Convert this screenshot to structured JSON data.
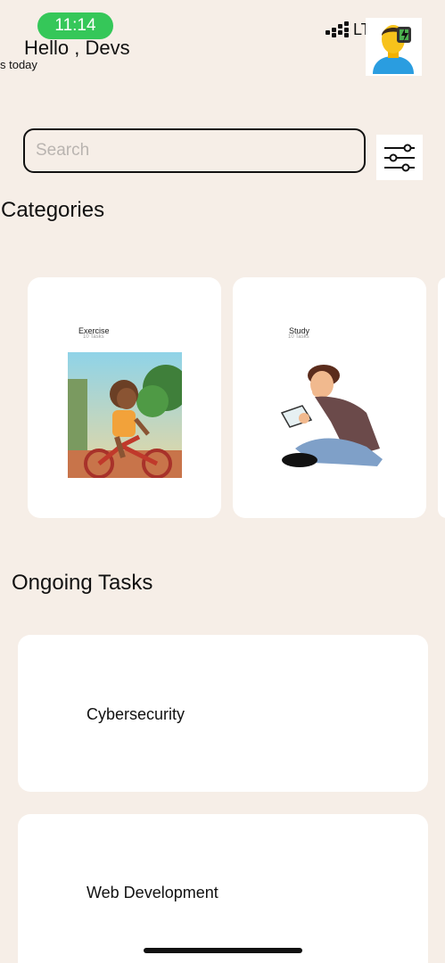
{
  "status_bar": {
    "time": "11:14",
    "network": "LTE",
    "accent_color": "#35c759"
  },
  "header": {
    "greeting": "Hello , Devs",
    "subtitle": "sks today",
    "avatar_icon": "user-avatar-icon"
  },
  "search": {
    "placeholder": "Search",
    "value": "",
    "filter_icon": "sliders-icon"
  },
  "categories": {
    "title": "Categories",
    "items": [
      {
        "title": "Exercise",
        "count": "10 Tasks",
        "image_icon": "boy-on-bicycle-illustration"
      },
      {
        "title": "Study",
        "count": "10 Tasks",
        "image_icon": "man-reading-book-illustration"
      }
    ]
  },
  "ongoing": {
    "title": "Ongoing Tasks",
    "tasks": [
      {
        "title": "Cybersecurity"
      },
      {
        "title": "Web Development"
      }
    ]
  },
  "colors": {
    "background": "#f6eee7",
    "card": "#ffffff",
    "text": "#111111"
  }
}
